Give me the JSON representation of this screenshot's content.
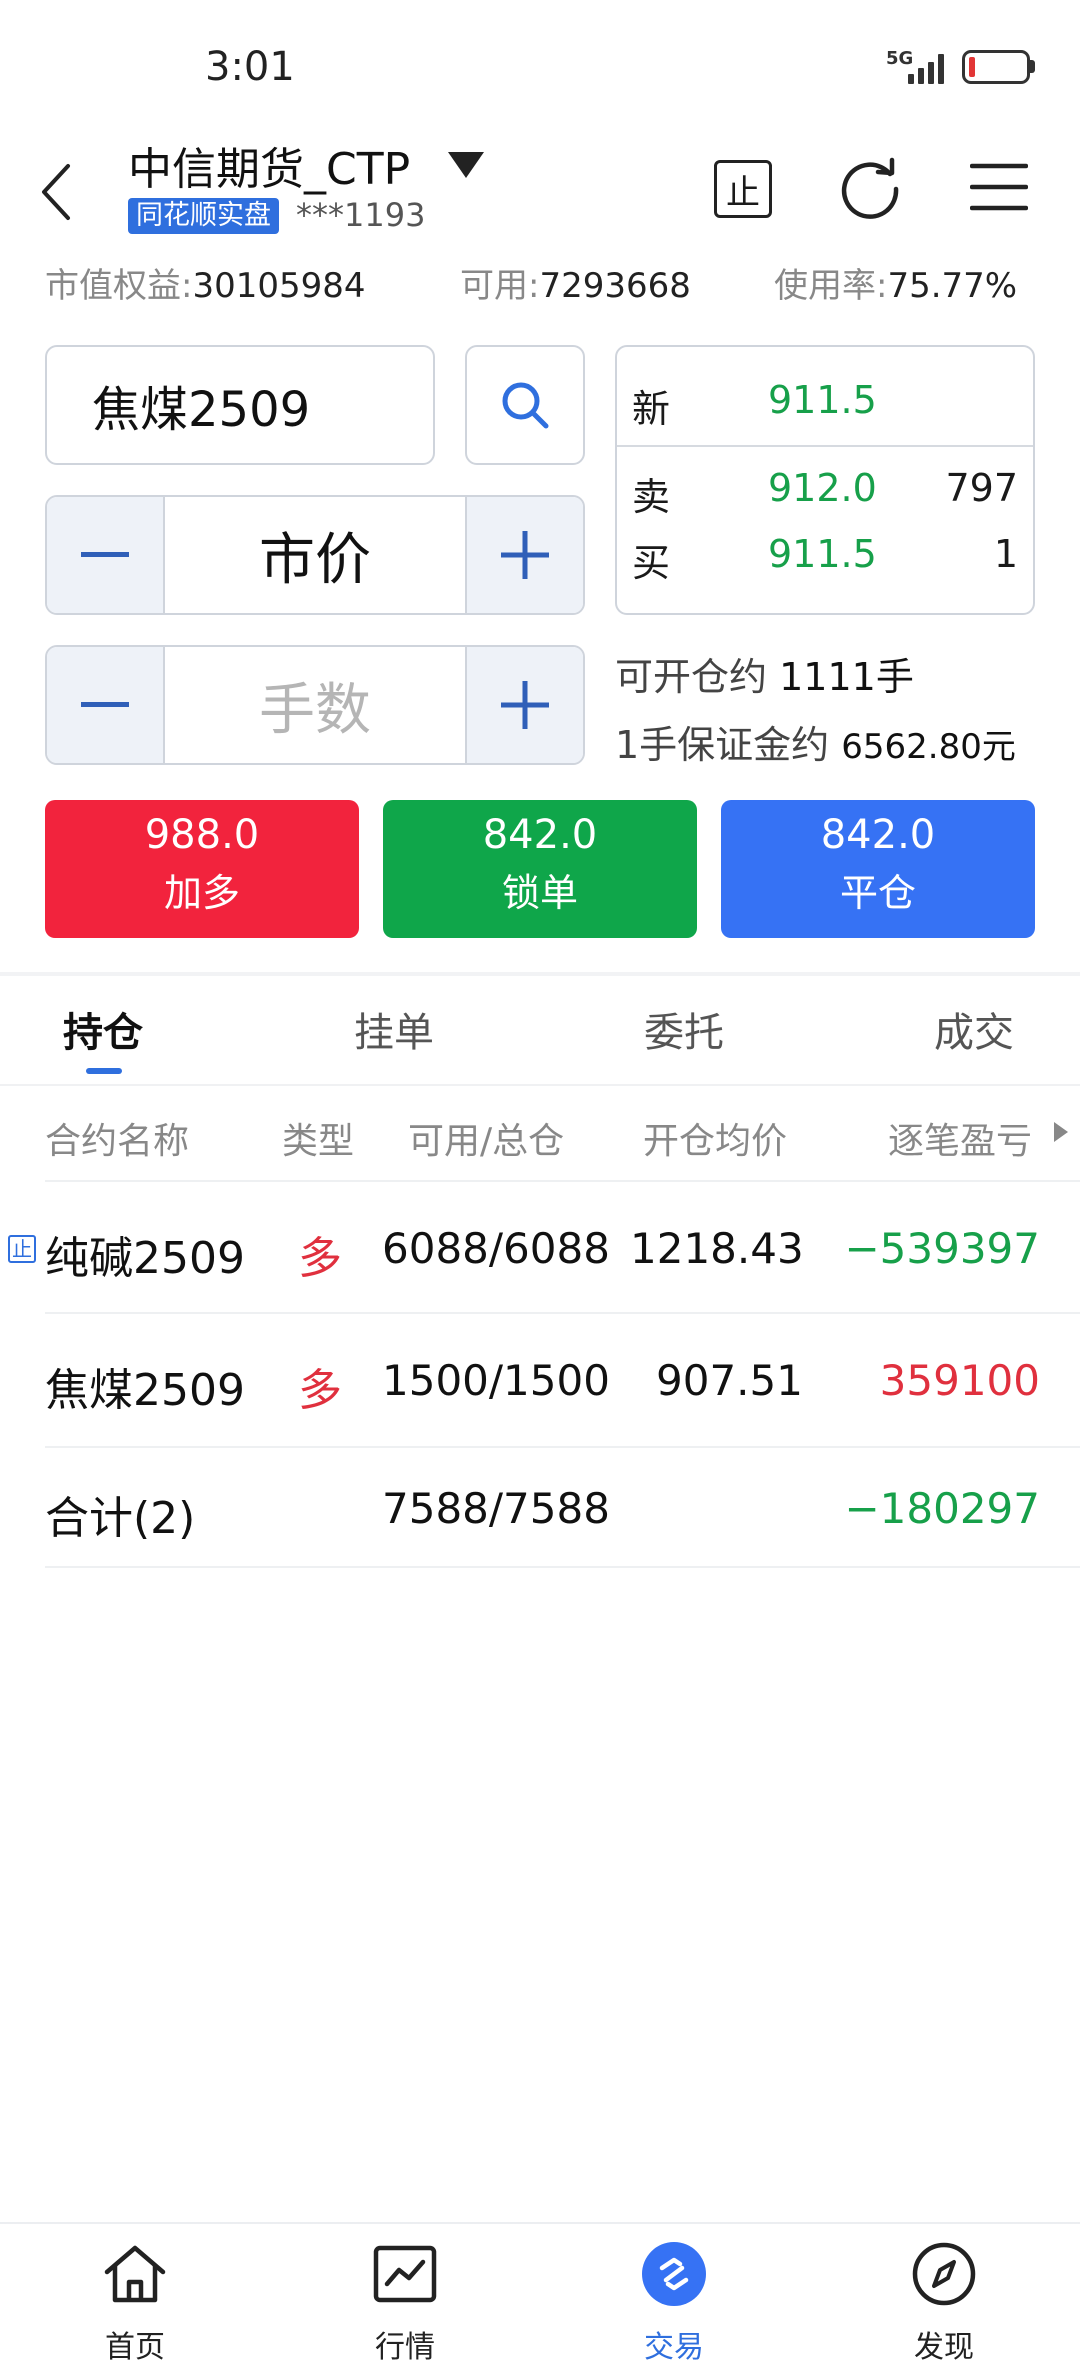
{
  "status_bar": {
    "time": "3:01",
    "network": "5G"
  },
  "header": {
    "account_name": "中信期货_CTP",
    "tag": "同花顺实盘",
    "account_no": "***1193",
    "stop_icon_char": "止"
  },
  "stats": {
    "equity_label": "市值权益:",
    "equity_value": "30105984",
    "available_label": "可用:",
    "available_value": "7293668",
    "usage_label": "使用率:",
    "usage_value": "75.77%"
  },
  "order": {
    "contract": "焦煤2509",
    "price_type": "市价",
    "quantity_placeholder": "手数",
    "minus": "−",
    "plus": "+"
  },
  "quote": {
    "last_label": "新",
    "last_price": "911.5",
    "ask_label": "卖",
    "ask_price": "912.0",
    "ask_volume": "797",
    "bid_label": "买",
    "bid_price": "911.5",
    "bid_volume": "1"
  },
  "capacity": {
    "open_label": "可开仓约",
    "open_value": "1111手",
    "margin_label": "1手保证金约",
    "margin_value": "6562.80元"
  },
  "actions": [
    {
      "price": "988.0",
      "label": "加多",
      "color": "#f2233d"
    },
    {
      "price": "842.0",
      "label": "锁单",
      "color": "#0fa64a"
    },
    {
      "price": "842.0",
      "label": "平仓",
      "color": "#3672f4"
    }
  ],
  "tabs": [
    "持仓",
    "挂单",
    "委托",
    "成交"
  ],
  "table": {
    "headers": [
      "合约名称",
      "类型",
      "可用/总仓",
      "开仓均价",
      "逐笔盈亏"
    ],
    "rows": [
      {
        "name": "纯碱2509",
        "type": "多",
        "qty": "6088/6088",
        "avg": "1218.43",
        "pnl": "−539397",
        "stop": "止"
      },
      {
        "name": "焦煤2509",
        "type": "多",
        "qty": "1500/1500",
        "avg": "907.51",
        "pnl": "359100"
      }
    ],
    "total": {
      "label": "合计(2)",
      "qty": "7588/7588",
      "pnl": "−180297"
    }
  },
  "nav": [
    {
      "label": "首页",
      "icon": "home-icon"
    },
    {
      "label": "行情",
      "icon": "chart-icon"
    },
    {
      "label": "交易",
      "icon": "trade-icon"
    },
    {
      "label": "发现",
      "icon": "compass-icon"
    }
  ]
}
